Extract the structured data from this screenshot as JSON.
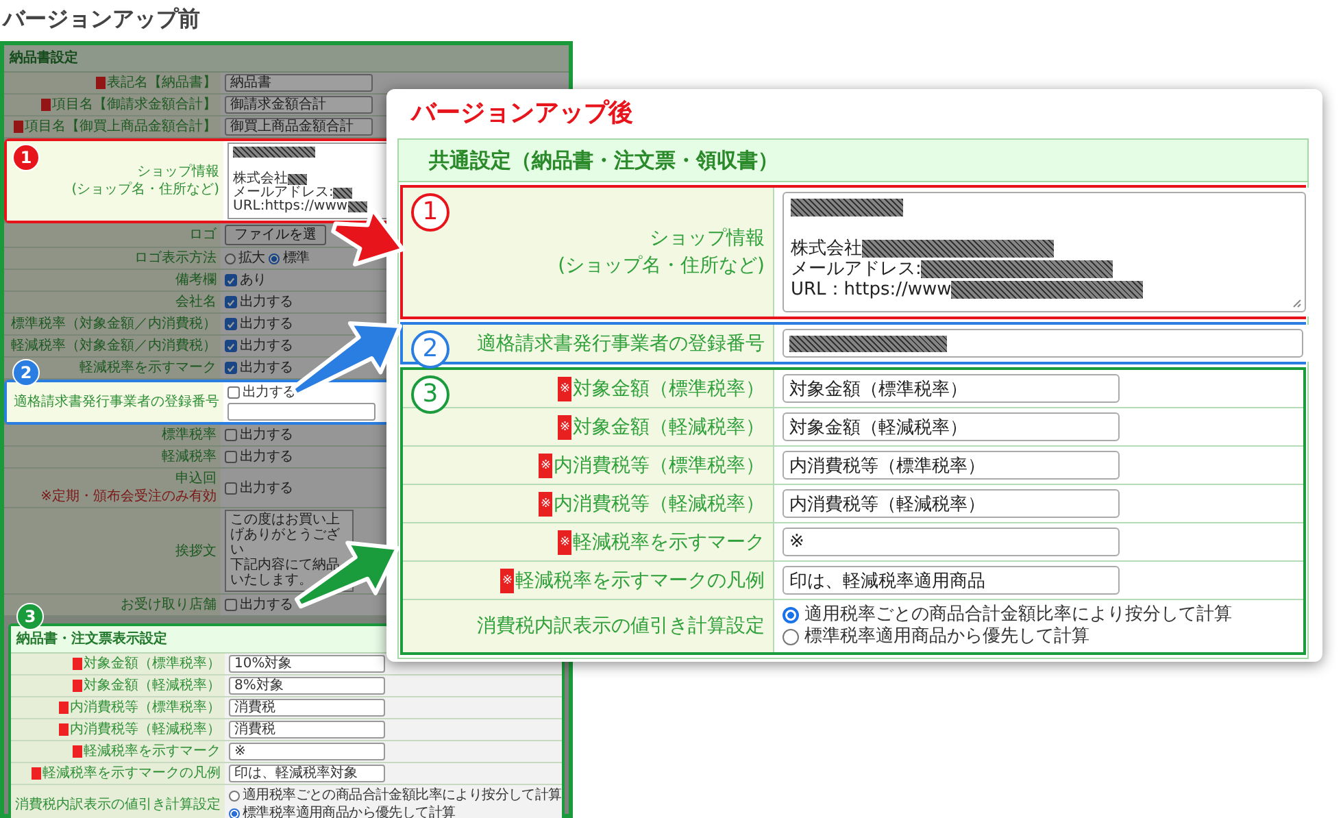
{
  "before": {
    "title": "バージョンアップ前",
    "sections": [
      {
        "title": "納品書設定",
        "dimmed": true,
        "rows": [
          {
            "label": "表記名【納品書】",
            "required": true,
            "kind": "input",
            "value": "納品書"
          },
          {
            "label": "項目名【御請求金額合計】",
            "required": true,
            "kind": "input",
            "value": "御請求金額合計"
          },
          {
            "label": "項目名【御買上商品金額合計】",
            "required": true,
            "kind": "input",
            "value": "御買上商品金額合計"
          },
          {
            "label": "ショップ情報",
            "sublabel": "(ショップ名・住所など)",
            "kind": "shop",
            "callout": {
              "number": "1",
              "color": "#e8141c"
            },
            "lines": [
              {
                "kind": "blur"
              },
              {
                "kind": "blank"
              },
              {
                "kind": "text_blur",
                "text": "株式会社"
              },
              {
                "kind": "text_blur",
                "text": "メールアドレス:"
              },
              {
                "kind": "text_blur",
                "text": "URL:https://www"
              }
            ]
          },
          {
            "label": "ロゴ",
            "kind": "file",
            "button": "ファイルを選"
          },
          {
            "label": "ロゴ表示方法",
            "kind": "radio",
            "options": [
              {
                "label": "拡大",
                "selected": false
              },
              {
                "label": "標準",
                "selected": true
              }
            ]
          },
          {
            "label": "備考欄",
            "kind": "check",
            "option": "あり",
            "checked": true
          },
          {
            "label": "会社名",
            "kind": "check",
            "option": "出力する",
            "checked": true
          },
          {
            "label": "標準税率（対象金額／内消費税）",
            "kind": "check",
            "option": "出力する",
            "checked": true
          },
          {
            "label": "軽減税率（対象金額／内消費税）",
            "kind": "check",
            "option": "出力する",
            "checked": true
          },
          {
            "label": "軽減税率を示すマーク",
            "kind": "check",
            "option": "出力する",
            "checked": true
          },
          {
            "label": "適格請求書発行事業者の登録番号",
            "kind": "check_input",
            "option": "出力する",
            "checked": false,
            "callout": {
              "number": "2",
              "color": "#2a7de1"
            }
          },
          {
            "label": "標準税率",
            "kind": "check",
            "option": "出力する",
            "checked": false
          },
          {
            "label": "軽減税率",
            "kind": "check",
            "option": "出力する",
            "checked": false
          },
          {
            "label": "申込回",
            "note": "※定期・頒布会受注のみ有効",
            "kind": "check",
            "option": "出力する",
            "checked": false
          },
          {
            "label": "挨拶文",
            "kind": "textarea",
            "lines": [
              "この度はお買い上げありがとうござい",
              "下記内容にて納品いたします。"
            ]
          },
          {
            "label": "お受け取り店舗",
            "kind": "check",
            "option": "出力する",
            "checked": false
          }
        ]
      },
      {
        "title": "納品書・注文票表示設定",
        "dimmed": false,
        "callout": {
          "number": "3",
          "color": "#1a9b3c"
        },
        "rows": [
          {
            "label": "対象金額（標準税率）",
            "required": true,
            "kind": "input",
            "value": "10%対象"
          },
          {
            "label": "対象金額（軽減税率）",
            "required": true,
            "kind": "input",
            "value": "8%対象"
          },
          {
            "label": "内消費税等（標準税率）",
            "required": true,
            "kind": "input",
            "value": "消費税"
          },
          {
            "label": "内消費税等（軽減税率）",
            "required": true,
            "kind": "input",
            "value": "消費税"
          },
          {
            "label": "軽減税率を示すマーク",
            "required": true,
            "kind": "input",
            "value": "※"
          },
          {
            "label": "軽減税率を示すマークの凡例",
            "required": true,
            "kind": "input",
            "value": "印は、軽減税率対象"
          },
          {
            "label": "消費税内訳表示の値引き計算設定",
            "kind": "radio_list",
            "options": [
              {
                "label": "適用税率ごとの商品合計金額比率により按分して計算",
                "selected": false
              },
              {
                "label": "標準税率適用商品から優先して計算",
                "selected": true
              }
            ]
          }
        ]
      }
    ]
  },
  "after": {
    "title": "バージョンアップ後",
    "table_title": "共通設定（納品書・注文票・領収書）",
    "groups": [
      {
        "callout": {
          "number": "1",
          "color": "#e8141c"
        },
        "rows": [
          {
            "label": "ショップ情報",
            "sublabel": "(ショップ名・住所など)",
            "kind": "shop",
            "lines": [
              {
                "kind": "blur"
              },
              {
                "kind": "blank"
              },
              {
                "kind": "text_blur",
                "text": "株式会社"
              },
              {
                "kind": "text_blur",
                "text": "メールアドレス:"
              },
              {
                "kind": "text_blur",
                "text": "URL：https://www"
              }
            ]
          }
        ]
      },
      {
        "callout": {
          "number": "2",
          "color": "#2a7de1"
        },
        "rows": [
          {
            "label": "適格請求書発行事業者の登録番号",
            "kind": "blurred_input"
          }
        ]
      },
      {
        "callout": {
          "number": "3",
          "color": "#1a9b3c"
        },
        "rows": [
          {
            "label": "対象金額（標準税率）",
            "mark": "※",
            "kind": "input",
            "value": "対象金額（標準税率）"
          },
          {
            "label": "対象金額（軽減税率）",
            "mark": "※",
            "kind": "input",
            "value": "対象金額（軽減税率）"
          },
          {
            "label": "内消費税等（標準税率）",
            "mark": "※",
            "kind": "input",
            "value": "内消費税等（標準税率）"
          },
          {
            "label": "内消費税等（軽減税率）",
            "mark": "※",
            "kind": "input",
            "value": "内消費税等（軽減税率）"
          },
          {
            "label": "軽減税率を示すマーク",
            "mark": "※",
            "kind": "input",
            "value": "※"
          },
          {
            "label": "軽減税率を示すマークの凡例",
            "mark": "※",
            "kind": "input",
            "value": "印は、軽減税率適用商品"
          },
          {
            "label": "消費税内訳表示の値引き計算設定",
            "kind": "radio_list",
            "options": [
              {
                "label": "適用税率ごとの商品合計金額比率により按分して計算",
                "selected": true
              },
              {
                "label": "標準税率適用商品から優先して計算",
                "selected": false
              }
            ]
          }
        ]
      }
    ]
  }
}
